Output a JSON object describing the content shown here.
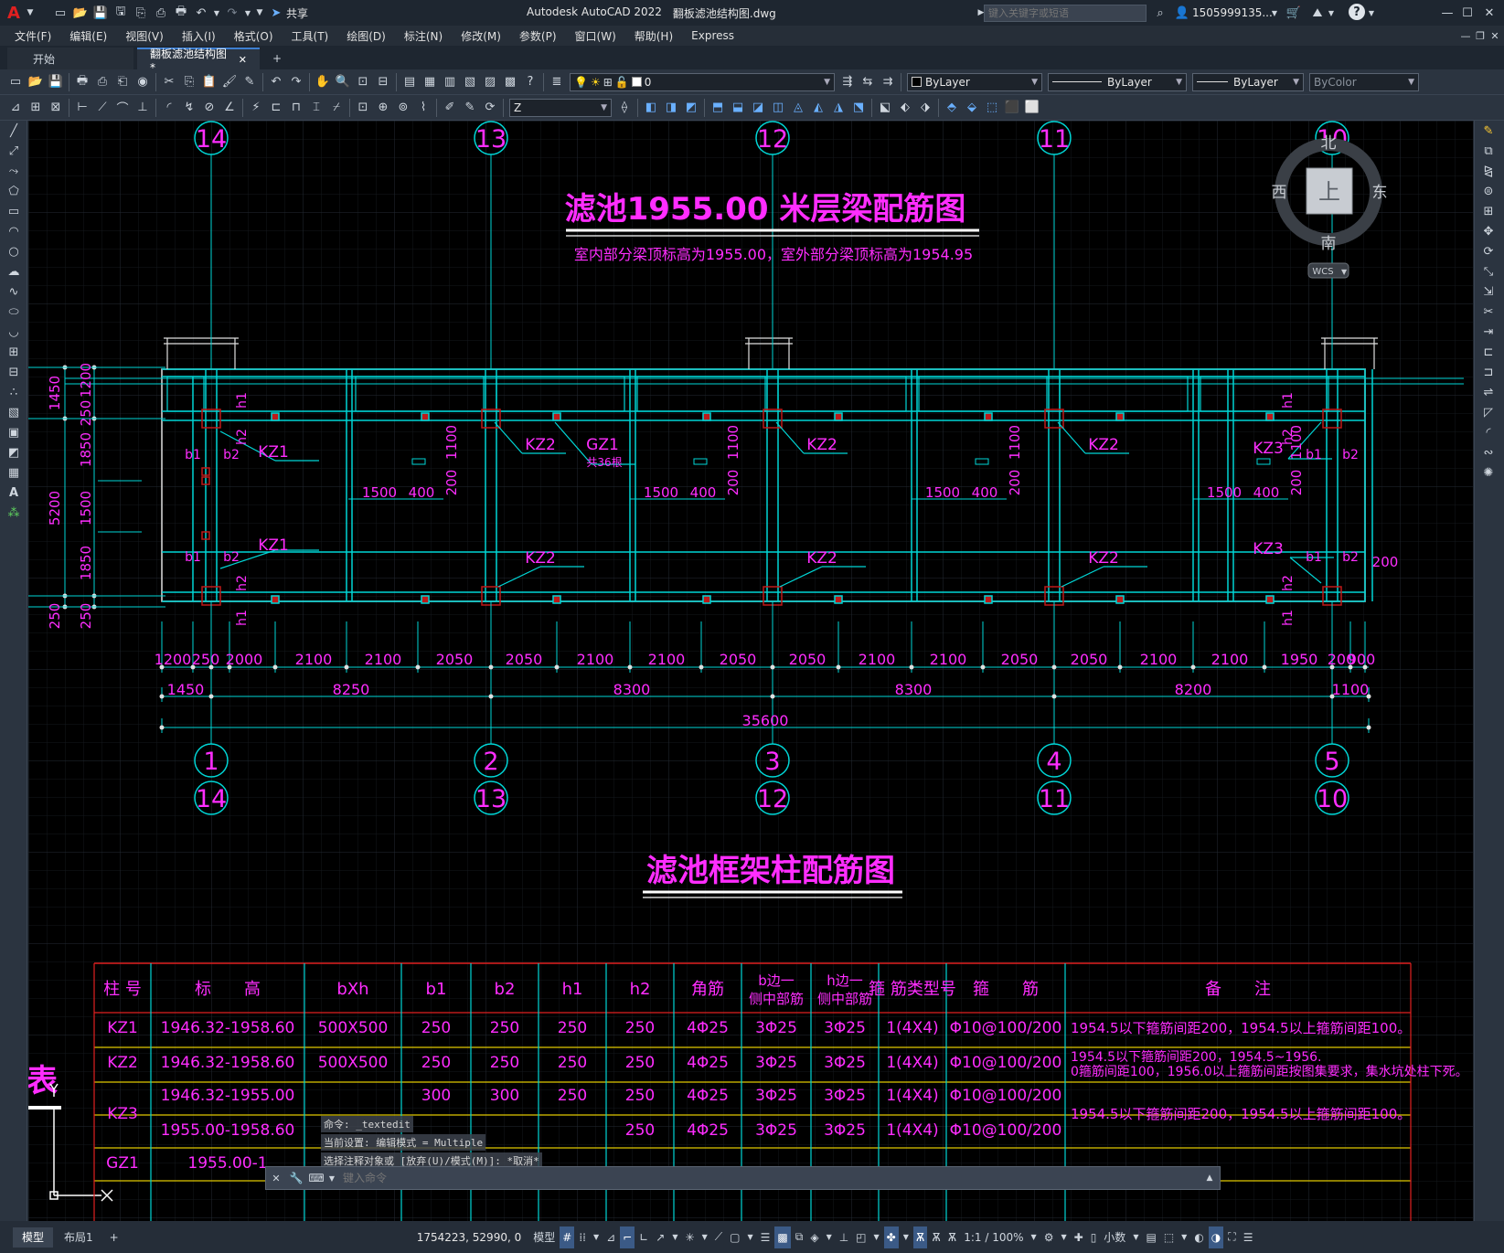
{
  "titlebar": {
    "app_logo": "A",
    "share_label": "共享",
    "app_title": "Autodesk AutoCAD 2022",
    "file_name": "翻板滤池结构图.dwg",
    "search_placeholder": "键入关键字或短语",
    "user_name": "1505999135...",
    "help_label": "?"
  },
  "menubar": {
    "items": [
      "文件(F)",
      "编辑(E)",
      "视图(V)",
      "插入(I)",
      "格式(O)",
      "工具(T)",
      "绘图(D)",
      "标注(N)",
      "修改(M)",
      "参数(P)",
      "窗口(W)",
      "帮助(H)",
      "Express"
    ]
  },
  "tabs": {
    "start_label": "开始",
    "doc_label": "翻板滤池结构图*"
  },
  "toolbar1": {
    "layer_value": "0",
    "color_value": "ByLayer",
    "linetype_value": "ByLayer",
    "lineweight_value": "ByLayer",
    "plotstyle_value": "ByColor"
  },
  "toolbar2": {
    "dimstyle_value": "Z"
  },
  "viewcube": {
    "north": "北",
    "south": "南",
    "east": "东",
    "west": "西",
    "top": "上",
    "wcs": "WCS"
  },
  "canvas": {
    "plan_title": "滤池1955.00 米层梁配筋图",
    "plan_subtitle": "室内部分梁顶标高为1955.00，室外部分梁顶标高为1954.95",
    "table_title": "滤池框架柱配筋图",
    "title_mark": "表",
    "top_axes": [
      "14",
      "13",
      "12",
      "11",
      "10"
    ],
    "bottom_axes_a": [
      "1",
      "2",
      "3",
      "4",
      "5"
    ],
    "bottom_axes_b": [
      "14",
      "13",
      "12",
      "11",
      "10"
    ],
    "dim_row1": [
      "1200",
      "250",
      "2000",
      "2100",
      "2100",
      "2050",
      "2050",
      "2100",
      "2100",
      "2050",
      "2050",
      "2100",
      "2100",
      "2050",
      "2050",
      "2100",
      "2100",
      "1950",
      "200",
      "900"
    ],
    "dim_row2": [
      "1450",
      "8250",
      "8300",
      "8300",
      "8200",
      "1100"
    ],
    "dim_total": "35600",
    "left_dims_a": [
      "1450",
      "5200",
      "250"
    ],
    "left_dims_b": [
      "1200",
      "250",
      "1850",
      "1500",
      "1850",
      "250"
    ],
    "right_dim": "200",
    "col_labels": {
      "kz1": "KZ1",
      "kz2": "KZ2",
      "kz3": "KZ3",
      "gz1": "GZ1",
      "gz1_note": "共36根",
      "b1": "b1",
      "b2": "b2",
      "h1": "h1",
      "h2": "h2",
      "d1500": "1500",
      "d400": "400",
      "d1100": "1100",
      "d200": "200"
    },
    "table_headers": [
      "柱 号",
      "标　　高",
      "bXh",
      "b1",
      "b2",
      "h1",
      "h2",
      "角筋",
      "b边一侧中部筋",
      "h边一侧中部筋",
      "箍 筋类型号",
      "箍　　筋",
      "备　　注"
    ],
    "table_rows": [
      [
        "KZ1",
        "1946.32-1958.60",
        "500X500",
        "250",
        "250",
        "250",
        "250",
        "4Φ25",
        "3Φ25",
        "3Φ25",
        "1(4X4)",
        "Φ10@100/200",
        "1954.5以下箍筋间距200，1954.5以上箍筋间距100。"
      ],
      [
        "KZ2",
        "1946.32-1958.60",
        "500X500",
        "250",
        "250",
        "250",
        "250",
        "4Φ25",
        "3Φ25",
        "3Φ25",
        "1(4X4)",
        "Φ10@100/200",
        "1954.5以下箍筋间距200，1954.5~1956.0箍筋间距100，1956.0以上箍筋间距按图集要求，集水坑处柱下死。"
      ],
      [
        "",
        "1946.32-1955.00",
        "",
        "300",
        "300",
        "250",
        "250",
        "4Φ25",
        "3Φ25",
        "3Φ25",
        "1(4X4)",
        "Φ10@100/200",
        ""
      ],
      [
        "",
        "1955.00-1958.60",
        "",
        "",
        "",
        "",
        "250",
        "4Φ25",
        "3Φ25",
        "3Φ25",
        "1(4X4)",
        "Φ10@100/200",
        ""
      ]
    ],
    "kz3_label": "KZ3",
    "kz3_remark": "1954.5以下箍筋间距200，1954.5以上箍筋间距100。",
    "table_partial_row": [
      "GZ1",
      "1955.00-1"
    ]
  },
  "command": {
    "history": [
      "命令: _textedit",
      "当前设置: 编辑模式 = Multiple",
      "选择注释对象或 [放弃(U)/模式(M)]: *取消*"
    ],
    "placeholder": "键入命令"
  },
  "status": {
    "tab_model": "模型",
    "tab_layout": "布局1",
    "coords": "1754223, 52990, 0",
    "model_label": "模型",
    "scale": "1:1 / 100%",
    "units": "小数"
  }
}
